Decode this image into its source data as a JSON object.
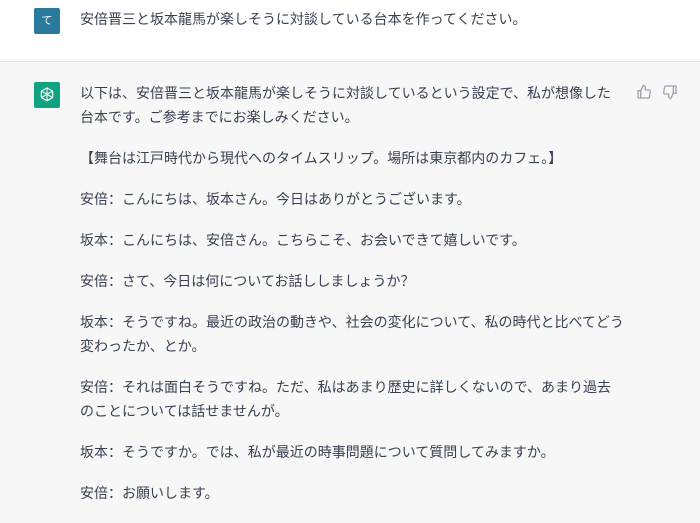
{
  "user_message": {
    "avatar_letter": "て",
    "text": "安倍晋三と坂本龍馬が楽しそうに対談している台本を作ってください。"
  },
  "assistant_message": {
    "paragraphs": [
      "以下は、安倍晋三と坂本龍馬が楽しそうに対談しているという設定で、私が想像した台本です。ご参考までにお楽しみください。",
      "【舞台は江戸時代から現代へのタイムスリップ。場所は東京都内のカフェ。】",
      "安倍：こんにちは、坂本さん。今日はありがとうございます。",
      "坂本：こんにちは、安倍さん。こちらこそ、お会いできて嬉しいです。",
      "安倍：さて、今日は何についてお話ししましょうか？",
      "坂本：そうですね。最近の政治の動きや、社会の変化について、私の時代と比べてどう変わったか、とか。",
      "安倍：それは面白そうですね。ただ、私はあまり歴史に詳しくないので、あまり過去のことについては話せませんが。",
      "坂本：そうですか。では、私が最近の時事問題について質問してみますか。",
      "安倍：お願いします。"
    ]
  },
  "colors": {
    "user_avatar_bg": "#2a7b9b",
    "assistant_avatar_bg": "#10a37f",
    "user_row_bg": "#ffffff",
    "assistant_row_bg": "#f7f7f8"
  },
  "icons": {
    "assistant_avatar": "openai-logo-icon",
    "feedback_up": "thumbs-up-icon",
    "feedback_down": "thumbs-down-icon"
  }
}
